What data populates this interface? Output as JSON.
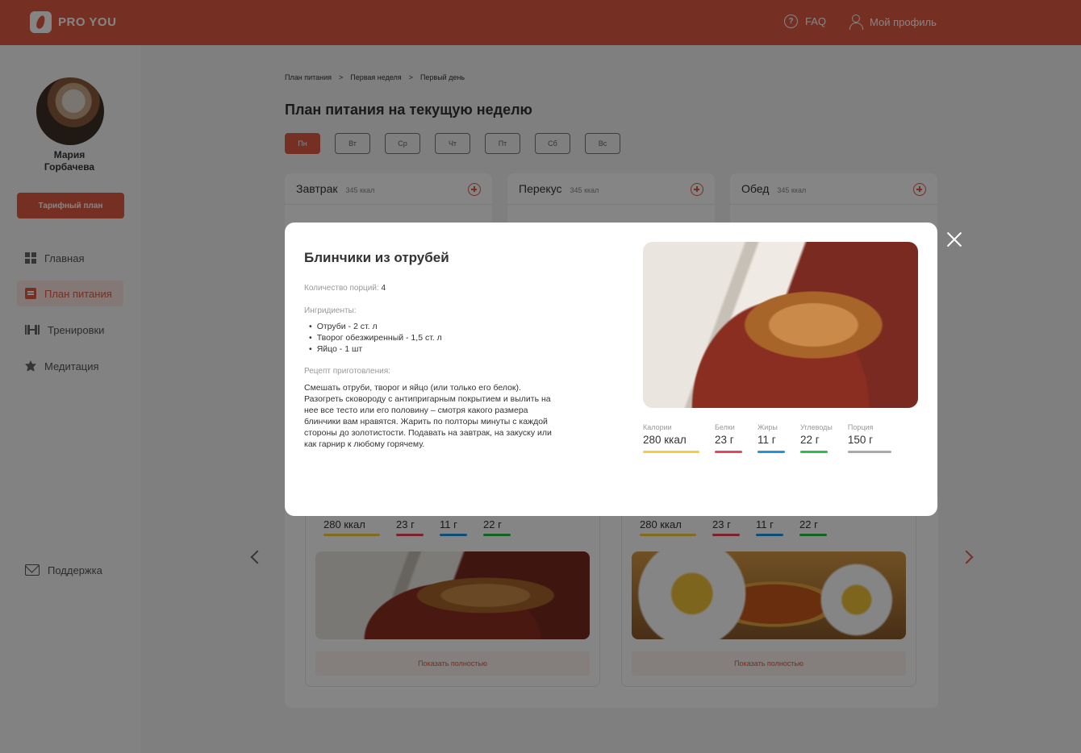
{
  "header": {
    "logo_text": "PRO YOU",
    "faq": "FAQ",
    "profile": "Мой профиль"
  },
  "sidebar": {
    "user_name_first": "Мария",
    "user_name_last": "Горбачева",
    "tariff_button": "Тарифный план",
    "items": [
      {
        "label": "Главная",
        "icon": "dashboard-icon"
      },
      {
        "label": "План питания",
        "icon": "book-icon",
        "active": true
      },
      {
        "label": "Тренировки",
        "icon": "dumbbell-icon"
      },
      {
        "label": "Медитация",
        "icon": "lotus-icon"
      }
    ],
    "support": "Поддержка"
  },
  "breadcrumb": [
    "План питания",
    ">",
    "Первая неделя",
    ">",
    "Первый день"
  ],
  "page_title": "План питания на текущую неделю",
  "days": [
    "Пн",
    "Вт",
    "Ср",
    "Чт",
    "Пт",
    "Сб",
    "Вс"
  ],
  "active_day": "Пн",
  "meals": [
    {
      "name": "Завтрак",
      "kcal": "345 ккал"
    },
    {
      "name": "Перекус",
      "kcal": "345 ккал"
    },
    {
      "name": "Обед",
      "kcal": "345 ккал"
    }
  ],
  "dish_cards": [
    {
      "calories": "280 ккал",
      "protein": "23 г",
      "fat": "11 г",
      "carbs": "22 г",
      "button": "Показать полностью",
      "image": "pancakes-photo"
    },
    {
      "calories": "280 ккал",
      "protein": "23 г",
      "fat": "11 г",
      "carbs": "22 г",
      "button": "Показать полностью",
      "image": "honey-photo"
    }
  ],
  "modal": {
    "title": "Блинчики из отрубей",
    "portions_label": "Количество порций:",
    "portions_value": "4",
    "ingredients_label": "Ингридиенты:",
    "ingredients": [
      "Отруби - 2 ст. л",
      "Творог обезжиренный - 1,5 ст. л",
      "Яйцо - 1 шт"
    ],
    "recipe_label": "Рецепт приготовления:",
    "recipe_text": "Смешать отруби, творог и яйцо (или только его белок). Разогреть сковороду с антипригарным покрытием и вылить на нее все тесто или его половину – смотря какого размера блинчики вам нравятся. Жарить по полторы минуты с каждой стороны до золотистости. Подавать на завтрак, на закуску или как гарнир к любому горячему.",
    "stats": [
      {
        "label": "Калории",
        "value": "280 ккал",
        "color": "#f5cd3d"
      },
      {
        "label": "Белки",
        "value": "23 г",
        "color": "#e8445a"
      },
      {
        "label": "Жиры",
        "value": "11 г",
        "color": "#1f95e0"
      },
      {
        "label": "Углеводы",
        "value": "22 г",
        "color": "#2bbf4a"
      },
      {
        "label": "Порция",
        "value": "150 г",
        "color": "#a9a9a9"
      }
    ]
  },
  "colors": {
    "accent": "#e05c43"
  }
}
